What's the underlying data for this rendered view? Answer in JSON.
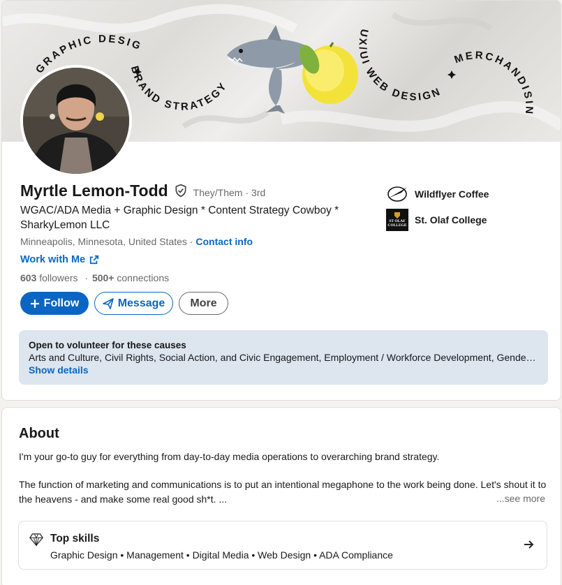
{
  "banner": {
    "arc_left_top": "GRAPHIC DESIGN",
    "arc_left_bottom": "BRAND STRATEGY",
    "arc_right_top": "UX/UI WEB DESIGN",
    "arc_right_far": "MERCHANDISING"
  },
  "profile": {
    "name": "Myrtle Lemon-Todd",
    "pronouns": "They/Them",
    "degree": "· 3rd",
    "headline": "WGAC/ADA Media + Graphic Design * Content Strategy Cowboy * SharkyLemon LLC",
    "location": "Minneapolis, Minnesota, United States",
    "location_sep": " · ",
    "contact_info": "Contact info",
    "work_link": "Work with Me",
    "followers": "603 followers",
    "connections_sep": "·",
    "connections": "500+ connections",
    "connections_count": "500+",
    "connections_word": " connections",
    "followers_count": "603",
    "followers_word": " followers"
  },
  "actions": {
    "follow": "Follow",
    "message": "Message",
    "more": "More"
  },
  "experience": [
    {
      "name": "Wildflyer Coffee"
    },
    {
      "name": "St. Olaf College",
      "logo_text_1": "ST OLAF",
      "logo_text_2": "COLLEGE"
    }
  ],
  "volunteer": {
    "title": "Open to volunteer for these causes",
    "causes": "Arts and Culture, Civil Rights, Social Action, and Civic Engagement, Employment / Workforce Development, Gender E...",
    "show_details": "Show details"
  },
  "about": {
    "title": "About",
    "paragraph1": "I'm your go-to guy for everything from day-to-day media operations to overarching brand strategy.",
    "paragraph2": "The function of marketing and communications is to put an intentional megaphone to the work being done. Let's shout it to the heavens - and make some real good sh*t. ...",
    "see_more": "...see more"
  },
  "skills": {
    "title": "Top skills",
    "list": "Graphic Design • Management • Digital Media • Web Design • ADA Compliance"
  },
  "colors": {
    "accent": "#0a66c2",
    "volunteer_bg": "#dde5ef",
    "page_bg": "#f4f2ee"
  }
}
